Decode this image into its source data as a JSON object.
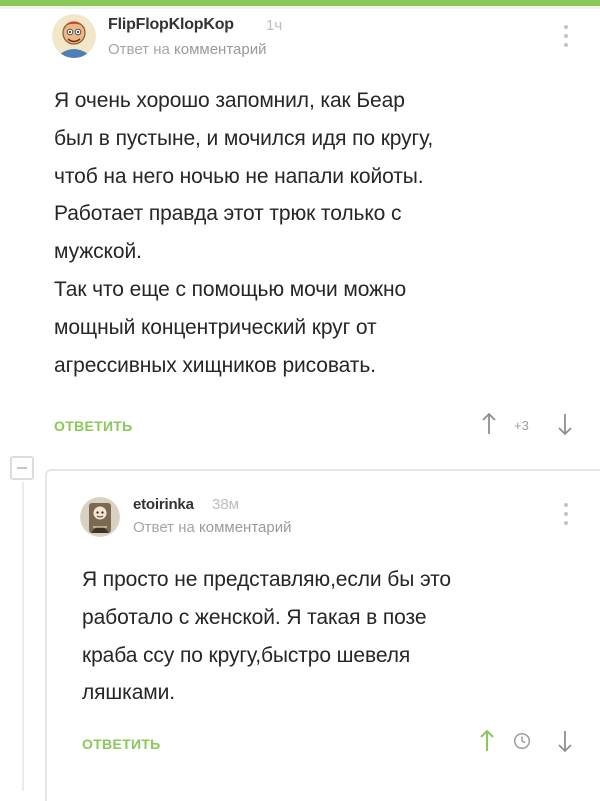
{
  "colors": {
    "accent": "#8ac858",
    "meta": "#a6a6a6"
  },
  "comment1": {
    "author": "FlipFlopKlopKop",
    "time": "1ч",
    "reply_prefix": "Ответ на ",
    "reply_target": "комментарий",
    "body": "Я очень хорошо запомнил, как Беар\nбыл в пустыне, и мочился идя по кругу,\nчтоб на него ночью не напали койоты.\nРаботает правда этот трюк только с\nмужской.\nТак что еще с помощью мочи можно\nмощный концентрический круг от\nагрессивных хищников рисовать.",
    "reply_label": "ОТВЕТИТЬ",
    "rating": "+3",
    "icons": {
      "avatar": "user-avatar-icon",
      "menu": "more-vert-icon",
      "up": "arrow-up-icon",
      "down": "arrow-down-icon"
    }
  },
  "comment2": {
    "author": "etoirinka",
    "time": "38м",
    "reply_prefix": "Ответ на ",
    "reply_target": "комментарий",
    "body": "Я просто не представляю,если бы это\nработало с женской. Я такая в позе\nкраба ссу по кругу,быстро шевеля\nляшками.",
    "reply_label": "ОТВЕТИТЬ",
    "icons": {
      "avatar": "user-avatar-icon",
      "menu": "more-vert-icon",
      "up": "arrow-up-icon",
      "clock": "clock-icon",
      "down": "arrow-down-icon"
    }
  },
  "thread": {
    "collapse_icon": "collapse-minus-icon"
  }
}
